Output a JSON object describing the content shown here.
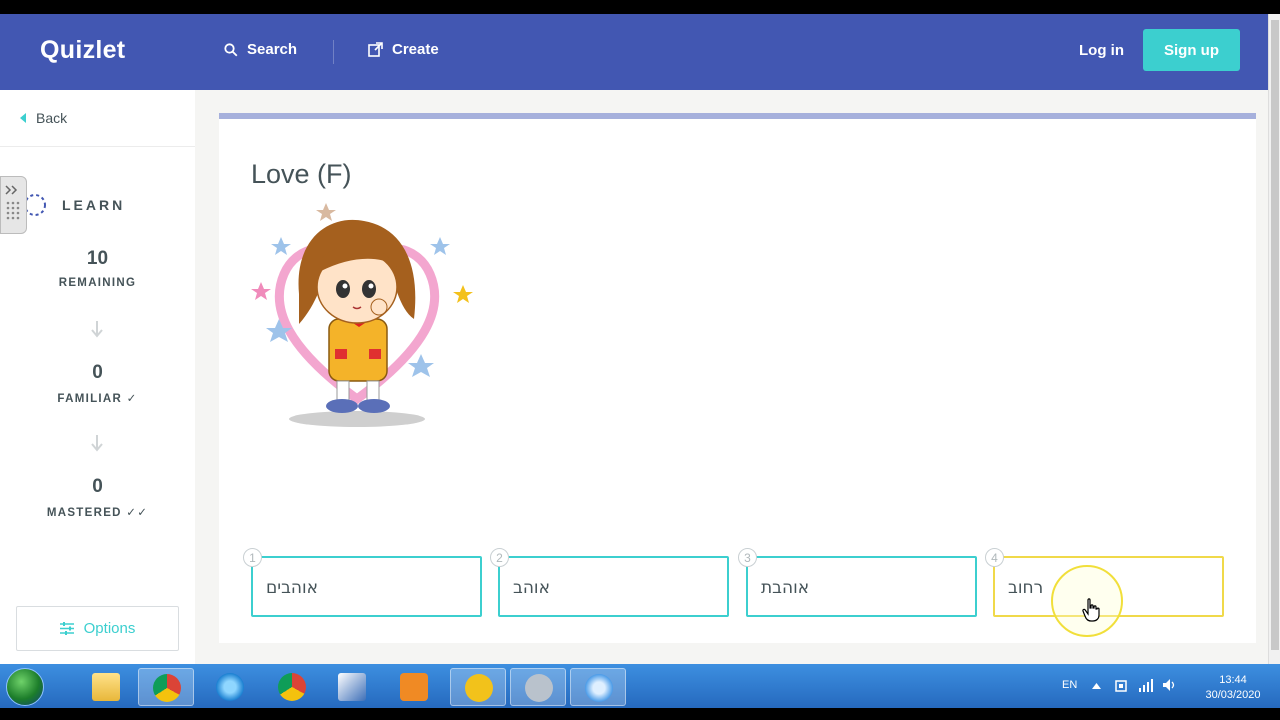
{
  "header": {
    "logo": "Quizlet",
    "search_label": "Search",
    "create_label": "Create",
    "login_label": "Log in",
    "signup_label": "Sign up",
    "bg_color": "#4257b2",
    "accent_color": "#3ccfcf"
  },
  "sidebar": {
    "back_label": "Back",
    "mode_label": "LEARN",
    "remaining": {
      "count": "10",
      "label": "REMAINING"
    },
    "familiar": {
      "count": "0",
      "label": "FAMILIAR ✓"
    },
    "mastered": {
      "count": "0",
      "label": "MASTERED ✓✓"
    },
    "options_label": "Options"
  },
  "question": {
    "prompt": "Love (F)",
    "image": "girl-cartoon-heart"
  },
  "choices": [
    {
      "number": "1",
      "text": "אוהבים"
    },
    {
      "number": "2",
      "text": "אוהב"
    },
    {
      "number": "3",
      "text": "אוהבת"
    },
    {
      "number": "4",
      "text": "רחוב"
    }
  ],
  "taskbar": {
    "language": "EN",
    "time": "13:44",
    "date": "30/03/2020"
  }
}
